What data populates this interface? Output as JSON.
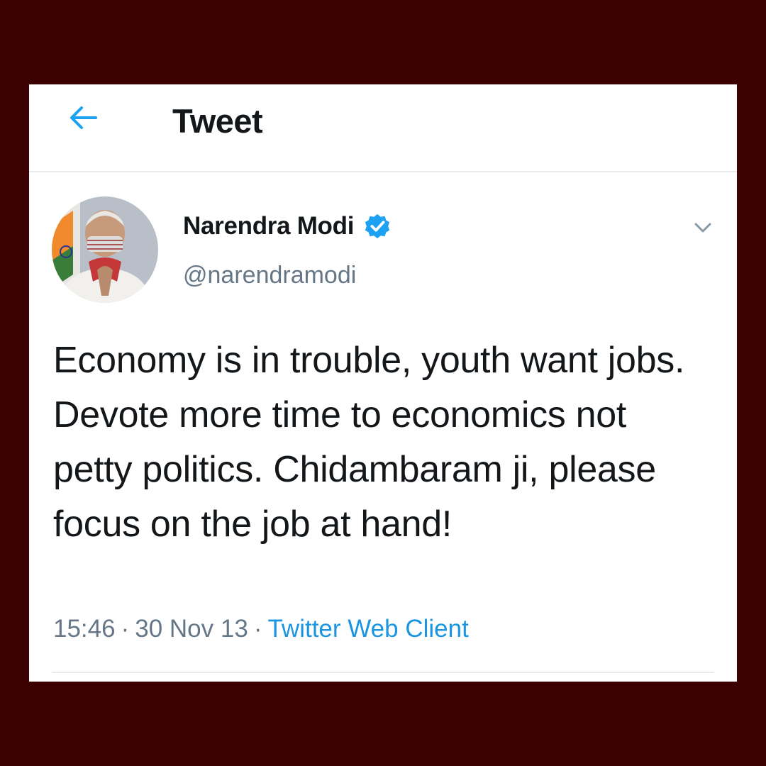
{
  "header": {
    "title": "Tweet",
    "back_icon": "arrow-left-icon"
  },
  "tweet": {
    "author_name": "Narendra Modi",
    "author_handle": "@narendramodi",
    "verified": true,
    "text": "Economy is in trouble, youth want jobs. Devote more time to economics not petty politics. Chidambaram ji, please focus on the job at hand!",
    "time": "15:46",
    "date": "30 Nov 13",
    "separator": "·",
    "source": "Twitter Web Client"
  },
  "colors": {
    "background": "#3d0000",
    "card": "#ffffff",
    "accent": "#1da1f2",
    "text_primary": "#14171a",
    "text_secondary": "#657786",
    "link": "#1b95e0"
  }
}
